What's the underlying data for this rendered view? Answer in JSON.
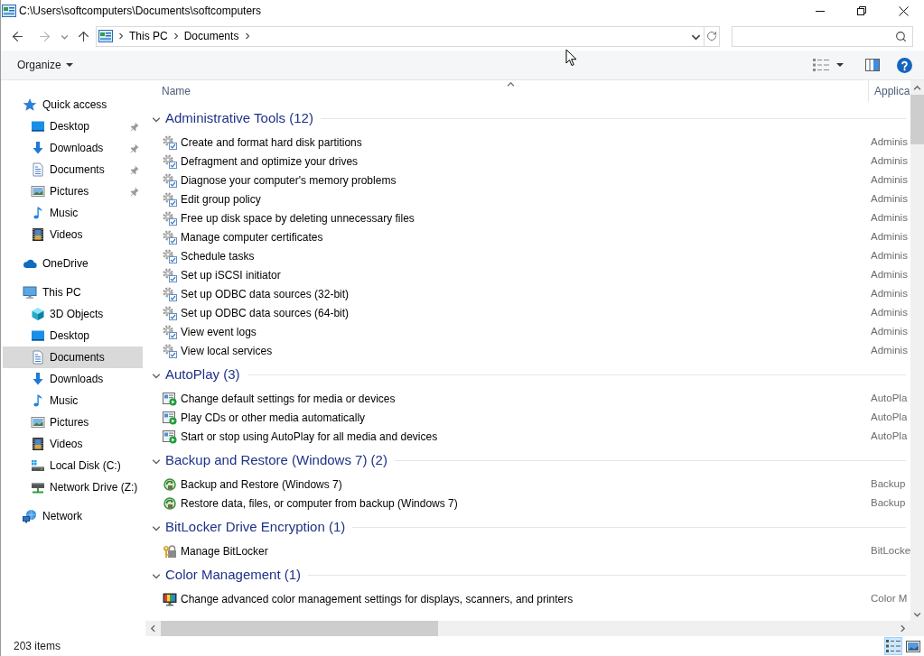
{
  "window": {
    "title": "C:\\Users\\softcomputers\\Documents\\softcomputers"
  },
  "address_bar": {
    "segments": [
      "This PC",
      "Documents"
    ]
  },
  "toolbar": {
    "organize": "Organize"
  },
  "sidebar": {
    "items": [
      {
        "label": "Quick access",
        "kind": "star",
        "selected": false,
        "children": [
          {
            "label": "Desktop",
            "kind": "desktop",
            "selected": false,
            "pinned": true
          },
          {
            "label": "Downloads",
            "kind": "downloads",
            "selected": false,
            "pinned": true
          },
          {
            "label": "Documents",
            "kind": "documents",
            "selected": false,
            "pinned": true
          },
          {
            "label": "Pictures",
            "kind": "pictures",
            "selected": false,
            "pinned": true
          },
          {
            "label": "Music",
            "kind": "music",
            "selected": false,
            "pinned": false
          },
          {
            "label": "Videos",
            "kind": "videos",
            "selected": false,
            "pinned": false
          }
        ]
      },
      {
        "label": "OneDrive",
        "kind": "cloud",
        "selected": false
      },
      {
        "label": "This PC",
        "kind": "computer",
        "selected": false,
        "children": [
          {
            "label": "3D Objects",
            "kind": "cube",
            "selected": false
          },
          {
            "label": "Desktop",
            "kind": "desktop",
            "selected": false
          },
          {
            "label": "Documents",
            "kind": "documents",
            "selected": true
          },
          {
            "label": "Downloads",
            "kind": "downloads",
            "selected": false
          },
          {
            "label": "Music",
            "kind": "music",
            "selected": false
          },
          {
            "label": "Pictures",
            "kind": "pictures",
            "selected": false
          },
          {
            "label": "Videos",
            "kind": "videos",
            "selected": false
          },
          {
            "label": "Local Disk (C:)",
            "kind": "disk",
            "selected": false
          },
          {
            "label": "Network Drive (Z:)",
            "kind": "network-drive",
            "selected": false
          }
        ]
      },
      {
        "label": "Network",
        "kind": "network",
        "selected": false
      }
    ]
  },
  "list": {
    "columns": [
      {
        "label": "Name",
        "sorted": true
      },
      {
        "label": "Applica",
        "sorted": false
      }
    ],
    "groups": [
      {
        "title": "Administrative Tools (12)",
        "kind": "admin",
        "expanded": true,
        "items": [
          {
            "name": "Create and format hard disk partitions",
            "column_2": "Adminis"
          },
          {
            "name": "Defragment and optimize your drives",
            "column_2": "Adminis"
          },
          {
            "name": "Diagnose your computer's memory problems",
            "column_2": "Adminis"
          },
          {
            "name": "Edit group policy",
            "column_2": "Adminis"
          },
          {
            "name": "Free up disk space by deleting unnecessary files",
            "column_2": "Adminis"
          },
          {
            "name": "Manage computer certificates",
            "column_2": "Adminis"
          },
          {
            "name": "Schedule tasks",
            "column_2": "Adminis"
          },
          {
            "name": "Set up iSCSI initiator",
            "column_2": "Adminis"
          },
          {
            "name": "Set up ODBC data sources (32-bit)",
            "column_2": "Adminis"
          },
          {
            "name": "Set up ODBC data sources (64-bit)",
            "column_2": "Adminis"
          },
          {
            "name": "View event logs",
            "column_2": "Adminis"
          },
          {
            "name": "View local services",
            "column_2": "Adminis"
          }
        ]
      },
      {
        "title": "AutoPlay (3)",
        "kind": "autoplay",
        "expanded": true,
        "items": [
          {
            "name": "Change default settings for media or devices",
            "column_2": "AutoPla"
          },
          {
            "name": "Play CDs or other media automatically",
            "column_2": "AutoPla"
          },
          {
            "name": "Start or stop using AutoPlay for all media and devices",
            "column_2": "AutoPla"
          }
        ]
      },
      {
        "title": "Backup and Restore (Windows 7) (2)",
        "kind": "backup",
        "expanded": true,
        "items": [
          {
            "name": "Backup and Restore (Windows 7)",
            "column_2": "Backup"
          },
          {
            "name": "Restore data, files, or computer from backup (Windows 7)",
            "column_2": "Backup"
          }
        ]
      },
      {
        "title": "BitLocker Drive Encryption (1)",
        "kind": "bitlocker",
        "expanded": true,
        "items": [
          {
            "name": "Manage BitLocker",
            "column_2": "BitLocke"
          }
        ]
      },
      {
        "title": "Color Management (1)",
        "kind": "color",
        "expanded": true,
        "items": [
          {
            "name": "Change advanced color management settings for displays, scanners, and printers",
            "column_2": "Color M"
          }
        ]
      }
    ]
  },
  "status_bar": {
    "count": "203 items",
    "views": [
      {
        "kind": "details",
        "selected": true
      },
      {
        "kind": "thumbnails",
        "selected": false
      }
    ]
  }
}
